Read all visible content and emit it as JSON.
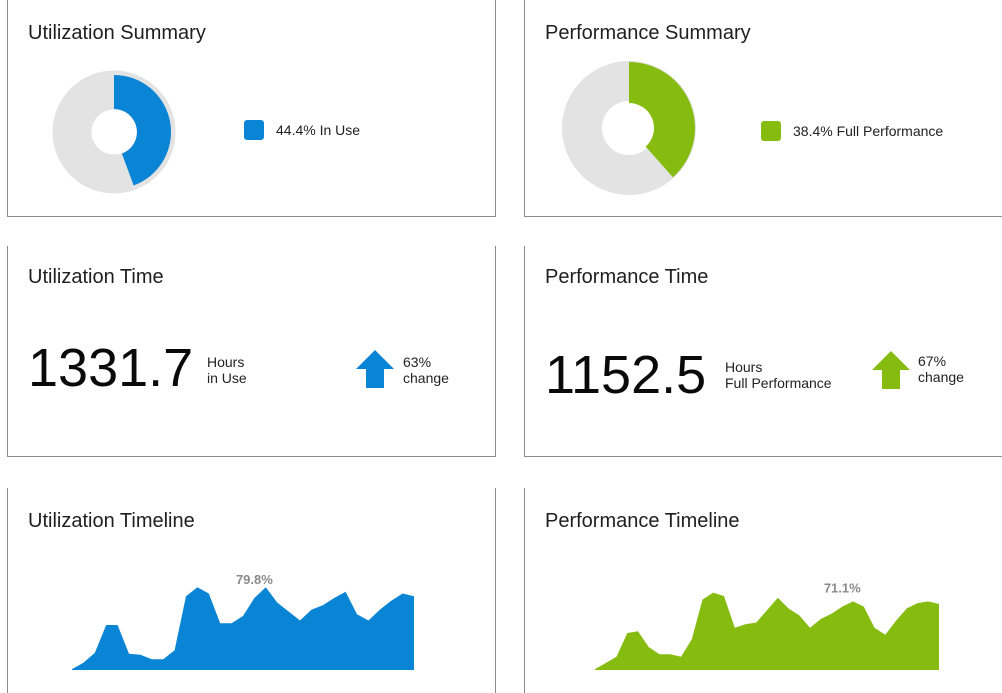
{
  "colors": {
    "blue": "#0a85d6",
    "green": "#86bc10",
    "track": "#e3e3e3",
    "peak_label": "#8a8a8a"
  },
  "utilization_summary": {
    "title": "Utilization Summary",
    "percent": 44.4,
    "legend": "44.4% In Use"
  },
  "performance_summary": {
    "title": "Performance Summary",
    "percent": 38.4,
    "legend": "38.4% Full Performance"
  },
  "utilization_time": {
    "title": "Utilization Time",
    "value": "1331.7",
    "unit_line1": "Hours",
    "unit_line2": "in Use",
    "change_line1": "63%",
    "change_line2": "change",
    "arrow_icon": "arrow-up-icon"
  },
  "performance_time": {
    "title": "Performance Time",
    "value": "1152.5",
    "unit_line1": "Hours",
    "unit_line2": "Full Performance",
    "change_line1": "67%",
    "change_line2": "change",
    "arrow_icon": "arrow-up-icon"
  },
  "chart_data": [
    {
      "type": "pie",
      "title": "Utilization Summary",
      "slices": [
        {
          "label": "In Use",
          "value": 44.4
        }
      ],
      "legend": "right"
    },
    {
      "type": "pie",
      "title": "Performance Summary",
      "slices": [
        {
          "label": "Full Performance",
          "value": 38.4
        }
      ],
      "legend": "right"
    },
    {
      "type": "area",
      "title": "Utilization Timeline",
      "peak_label": "79.8%",
      "peak_index": 16,
      "ylim": [
        0,
        100
      ],
      "values": [
        1,
        8,
        19,
        50,
        50,
        18,
        17,
        12,
        12,
        22,
        82,
        92,
        85,
        52,
        52,
        60,
        80,
        92,
        75,
        65,
        55,
        67,
        72,
        80,
        87,
        62,
        55,
        67,
        77,
        85,
        82
      ]
    },
    {
      "type": "area",
      "title": "Performance Timeline",
      "peak_label": "71.1%",
      "peak_index": 23,
      "ylim": [
        0,
        100
      ],
      "values": [
        1,
        8,
        15,
        42,
        44,
        26,
        18,
        18,
        15,
        35,
        80,
        88,
        84,
        48,
        52,
        54,
        68,
        82,
        70,
        62,
        48,
        58,
        64,
        72,
        78,
        72,
        48,
        40,
        56,
        70,
        76,
        78,
        75
      ]
    }
  ]
}
